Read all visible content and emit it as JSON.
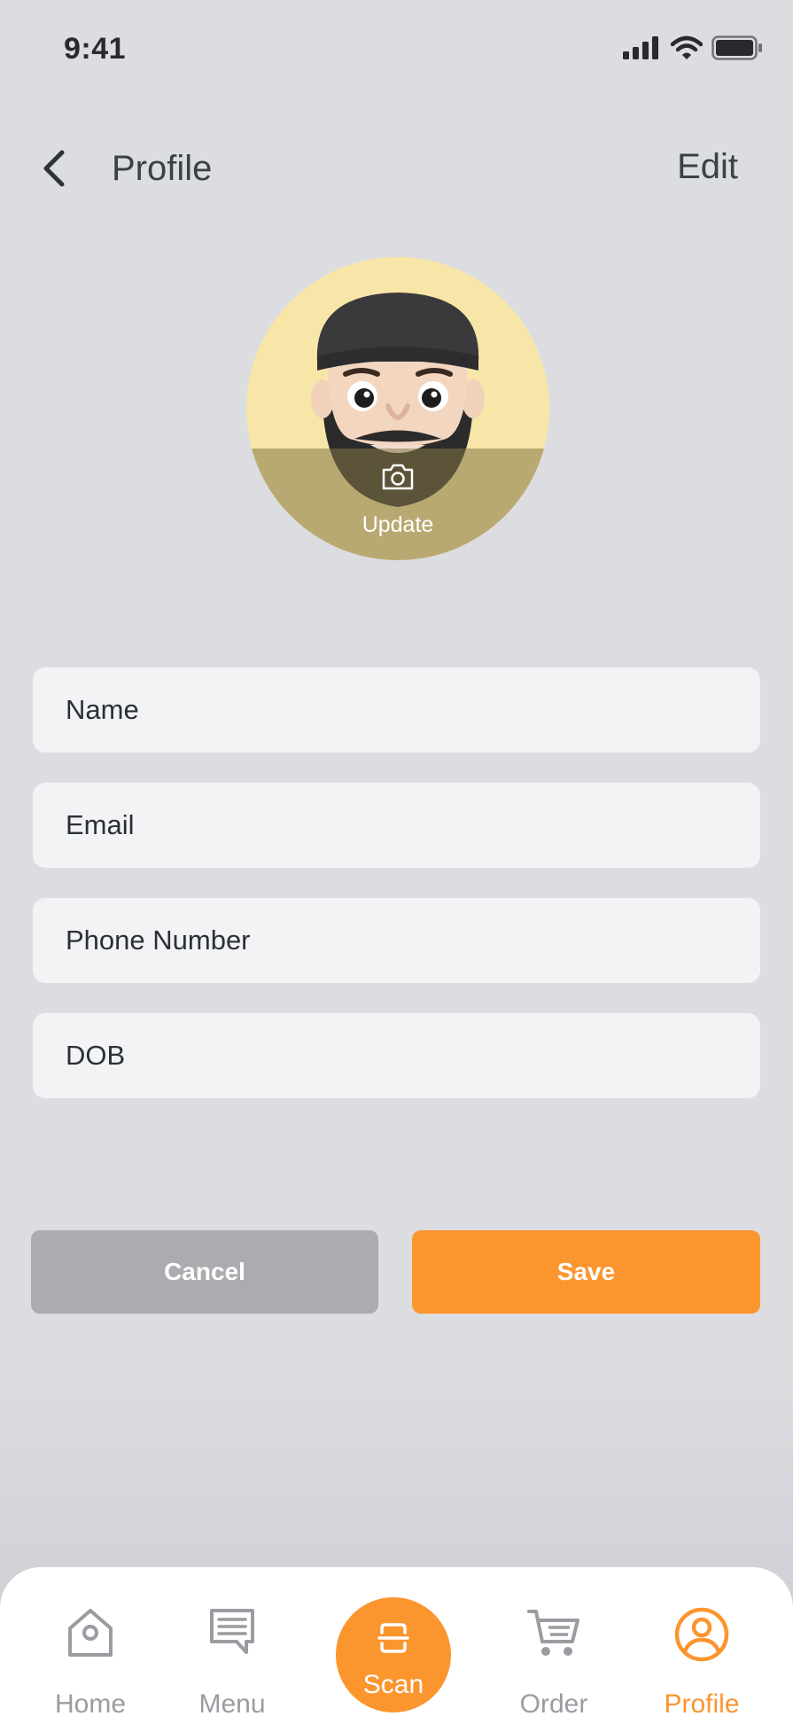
{
  "status_bar": {
    "time": "9:41",
    "icons": [
      "signal-icon",
      "wifi-icon",
      "battery-icon"
    ]
  },
  "header": {
    "title": "Profile",
    "edit_label": "Edit",
    "back_icon": "chevron-left-icon"
  },
  "avatar": {
    "update_label": "Update",
    "camera_icon": "camera-icon"
  },
  "form": {
    "name_placeholder": "Name",
    "email_placeholder": "Email",
    "phone_placeholder": "Phone Number",
    "dob_placeholder": "DOB"
  },
  "actions": {
    "cancel_label": "Cancel",
    "save_label": "Save"
  },
  "tab_bar": {
    "items": [
      {
        "label": "Home",
        "icon": "home-icon"
      },
      {
        "label": "Menu",
        "icon": "menu-icon"
      },
      {
        "label": "Scan",
        "icon": "scan-icon"
      },
      {
        "label": "Order",
        "icon": "cart-icon"
      },
      {
        "label": "Profile",
        "icon": "profile-icon"
      }
    ],
    "active": "Profile"
  },
  "colors": {
    "accent": "#fb952e",
    "background": "#dcdde1",
    "field_bg": "#f2f3f5",
    "cancel_bg": "#abacaf",
    "inactive_tab": "#9a9ca1"
  }
}
